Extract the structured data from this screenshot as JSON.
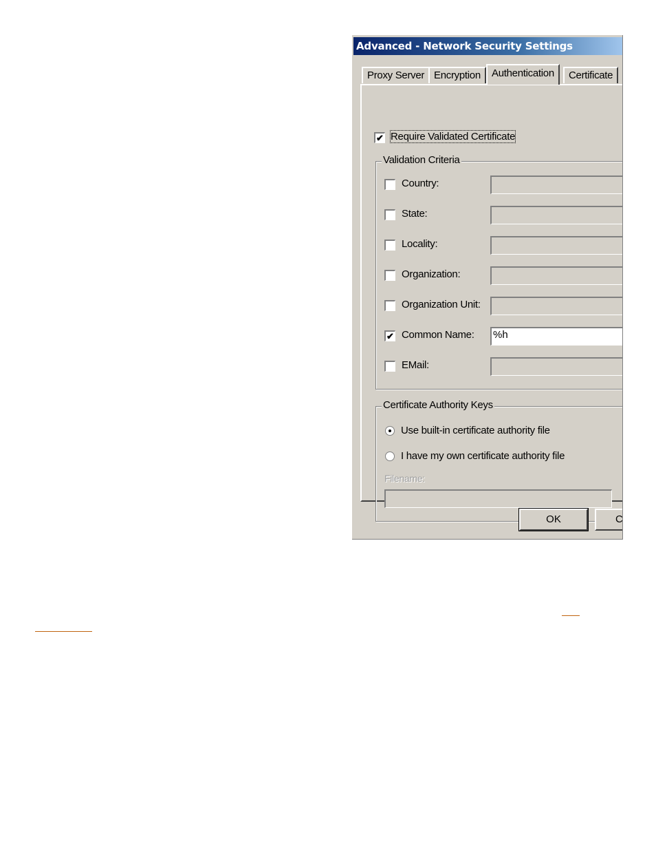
{
  "dialog": {
    "title": "Advanced - Network Security Settings",
    "tabs": [
      {
        "label": "Proxy Server",
        "active": false
      },
      {
        "label": "Encryption",
        "active": false
      },
      {
        "label": "Authentication",
        "active": true
      },
      {
        "label": "Certificate",
        "active": false
      }
    ],
    "require_validated_certificate": {
      "label": "Require Validated Certificate",
      "checked": true
    },
    "validation_criteria": {
      "title": "Validation Criteria",
      "rows": [
        {
          "label": "Country:",
          "checked": false,
          "value": ""
        },
        {
          "label": "State:",
          "checked": false,
          "value": ""
        },
        {
          "label": "Locality:",
          "checked": false,
          "value": ""
        },
        {
          "label": "Organization:",
          "checked": false,
          "value": ""
        },
        {
          "label": "Organization Unit:",
          "checked": false,
          "value": ""
        },
        {
          "label": "Common Name:",
          "checked": true,
          "value": "%h"
        },
        {
          "label": "EMail:",
          "checked": false,
          "value": ""
        }
      ]
    },
    "ca_keys": {
      "title": "Certificate Authority Keys",
      "options": [
        {
          "label": "Use built-in certificate authority file",
          "selected": true
        },
        {
          "label": "I have my own certificate authority file",
          "selected": false
        }
      ],
      "filename_label": "Filename:",
      "filename_value": ""
    },
    "buttons": {
      "ok": "OK",
      "cancel_partial": "C"
    }
  },
  "colors": {
    "link": "#c0630f",
    "dialog_bg": "#d4d0c8",
    "title_start": "#0a246a",
    "title_end": "#a6caf0"
  }
}
